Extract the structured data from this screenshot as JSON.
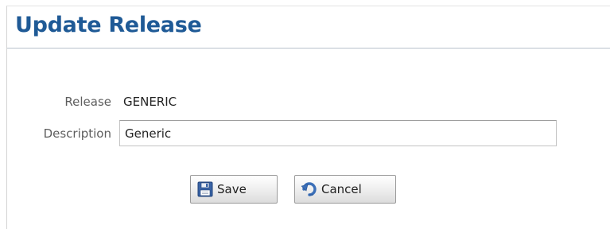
{
  "page": {
    "title": "Update Release"
  },
  "form": {
    "release_label": "Release",
    "release_value": "GENERIC",
    "description_label": "Description",
    "description_value": "Generic"
  },
  "actions": {
    "save_label": "Save",
    "cancel_label": "Cancel",
    "save_icon": "floppy-disk-icon",
    "cancel_icon": "undo-icon"
  },
  "colors": {
    "title": "#1f5a96",
    "label": "#5e5e5e"
  }
}
